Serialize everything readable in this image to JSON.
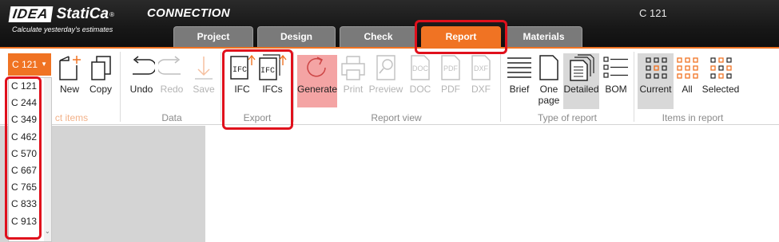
{
  "app": {
    "brand_idea": "IDEA",
    "brand_statica": "StatiCa",
    "brand_reg": "®",
    "product": "CONNECTION",
    "tagline": "Calculate yesterday's estimates",
    "window_title": "C 121"
  },
  "tabs": [
    {
      "label": "Project"
    },
    {
      "label": "Design"
    },
    {
      "label": "Check"
    },
    {
      "label": "Report",
      "active": true
    },
    {
      "label": "Materials"
    }
  ],
  "item_selector": {
    "current": "C 121",
    "options": [
      "C 121",
      "C 244",
      "C 349",
      "C 462",
      "C 570",
      "C 667",
      "C 765",
      "C 833",
      "C 913"
    ],
    "group_label_visible": "ct items"
  },
  "ribbon": {
    "select_items": {
      "new": "New",
      "copy": "Copy"
    },
    "data": {
      "undo": "Undo",
      "redo": "Redo",
      "save": "Save",
      "label": "Data"
    },
    "export": {
      "ifc": "IFC",
      "ifcs": "IFCs",
      "label": "Export",
      "icon_text": "IFC"
    },
    "report_view": {
      "generate": "Generate",
      "print": "Print",
      "preview": "Preview",
      "doc": "DOC",
      "pdf": "PDF",
      "dxf": "DXF",
      "label": "Report view"
    },
    "type_of_report": {
      "brief": "Brief",
      "one_page_1": "One",
      "one_page_2": "page",
      "detailed": "Detailed",
      "bom": "BOM",
      "label": "Type of report"
    },
    "items_in_report": {
      "current": "Current",
      "all": "All",
      "selected": "Selected",
      "label": "Items in report"
    }
  },
  "colors": {
    "accent": "#f07323",
    "highlight": "#e0101c",
    "generate_bg": "#f4a4a4"
  }
}
